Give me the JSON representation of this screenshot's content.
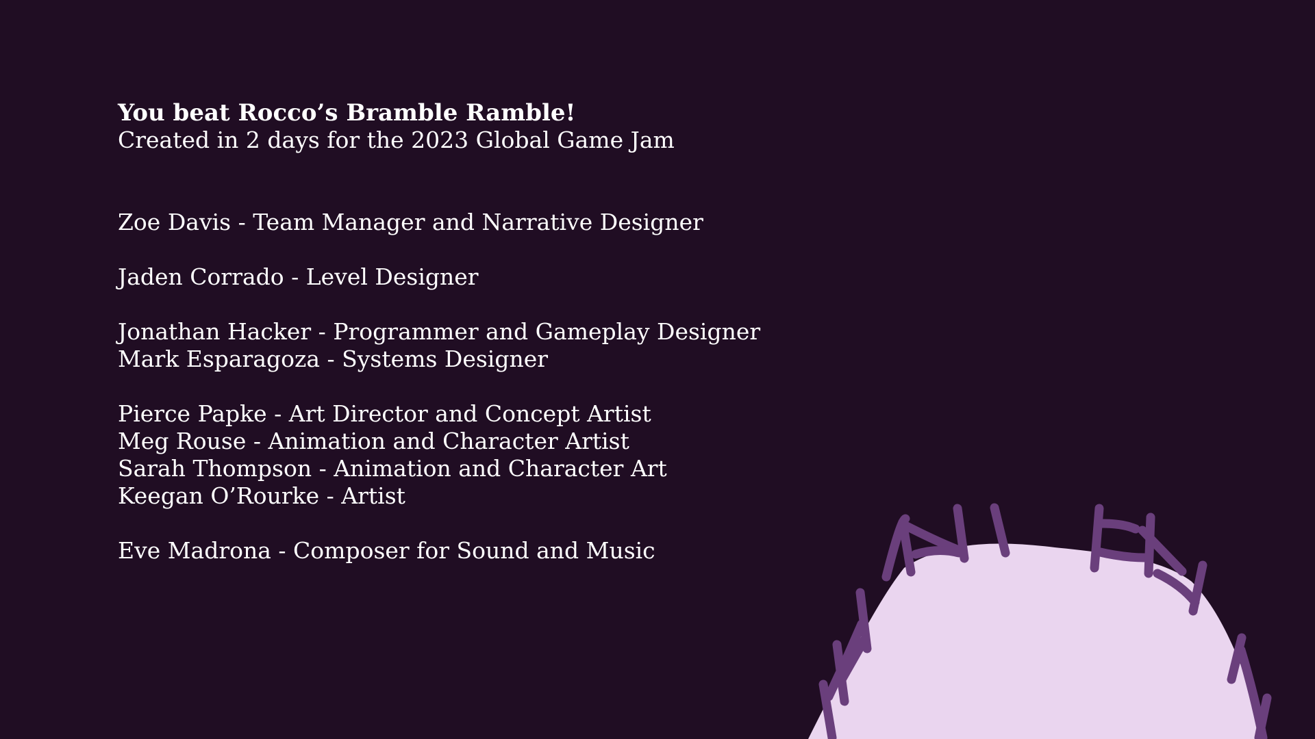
{
  "screen": {
    "background_color": "#200d23",
    "text_color": "#ffffff",
    "hill_color": "#ead5ef",
    "fence_color": "#6a3f7c"
  },
  "header": {
    "title": "You beat Rocco’s Bramble Ramble!",
    "subtitle": "Created in 2 days for the 2023 Global Game Jam"
  },
  "credits": {
    "groups": [
      [
        "Zoe Davis - Team Manager and Narrative Designer"
      ],
      [
        "Jaden Corrado - Level Designer"
      ],
      [
        "Jonathan Hacker - Programmer and Gameplay Designer",
        "Mark Esparagoza - Systems Designer"
      ],
      [
        "Pierce Papke - Art Director and Concept Artist",
        "Meg Rouse - Animation and Character Artist",
        "Sarah Thompson - Animation and Character Art",
        "Keegan O’Rourke - Artist"
      ],
      [
        "Eve Madrona - Composer for Sound and Music"
      ]
    ]
  }
}
